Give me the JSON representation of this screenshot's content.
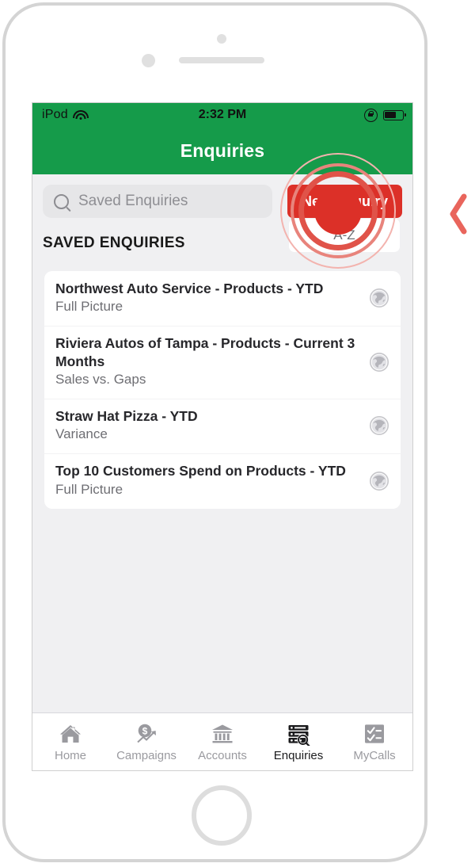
{
  "device": {
    "name": "iPod-touch-mockup",
    "camera_icon": "camera-dot",
    "speaker_icon": "speaker-grille",
    "sensor_icon": "proximity-sensor-dot",
    "home_button_icon": "home-button-circle"
  },
  "status_bar": {
    "carrier": "iPod",
    "wifi_icon": "wifi-icon",
    "time": "2:32 PM",
    "rotation_lock_icon": "rotation-lock-icon",
    "battery_icon": "battery-icon",
    "battery_level_percent": 62
  },
  "nav_bar": {
    "title": "Enquiries",
    "background_color": "#159B4A",
    "title_color": "#FFFFFF"
  },
  "search": {
    "icon": "search-icon",
    "placeholder": "Saved Enquiries",
    "value": ""
  },
  "actions": {
    "new_enquiry_label": "New Enquiry",
    "new_enquiry_color": "#DC3028",
    "sort_label": "A-Z"
  },
  "section": {
    "title": "SAVED ENQUIRIES"
  },
  "list": {
    "items": [
      {
        "title": "Northwest Auto Service - Products - YTD",
        "subtitle": "Full Picture",
        "icon": "globe-icon"
      },
      {
        "title": "Riviera Autos of Tampa - Products - Current 3 Months",
        "subtitle": "Sales vs. Gaps",
        "icon": "globe-icon"
      },
      {
        "title": "Straw Hat Pizza - YTD",
        "subtitle": "Variance",
        "icon": "globe-icon"
      },
      {
        "title": "Top 10 Customers Spend on Products - YTD",
        "subtitle": "Full Picture",
        "icon": "globe-icon"
      }
    ]
  },
  "tab_bar": {
    "items": [
      {
        "label": "Home",
        "icon": "house-icon",
        "active": false
      },
      {
        "label": "Campaigns",
        "icon": "dollar-trend-icon",
        "active": false
      },
      {
        "label": "Accounts",
        "icon": "bank-icon",
        "active": false
      },
      {
        "label": "Enquiries",
        "icon": "database-search-icon",
        "active": true
      },
      {
        "label": "MyCalls",
        "icon": "checklist-icon",
        "active": false
      }
    ],
    "active_color": "#1C1C1E",
    "inactive_color": "#9A9A9F"
  },
  "annotations": {
    "tap_indicator_icon": "tap-target-rings",
    "tap_indicator_color": "#DC3028",
    "tap_target": "New Enquiry",
    "side_chevron_icon": "chevron-left-icon",
    "side_chevron_color": "#E9655C"
  }
}
